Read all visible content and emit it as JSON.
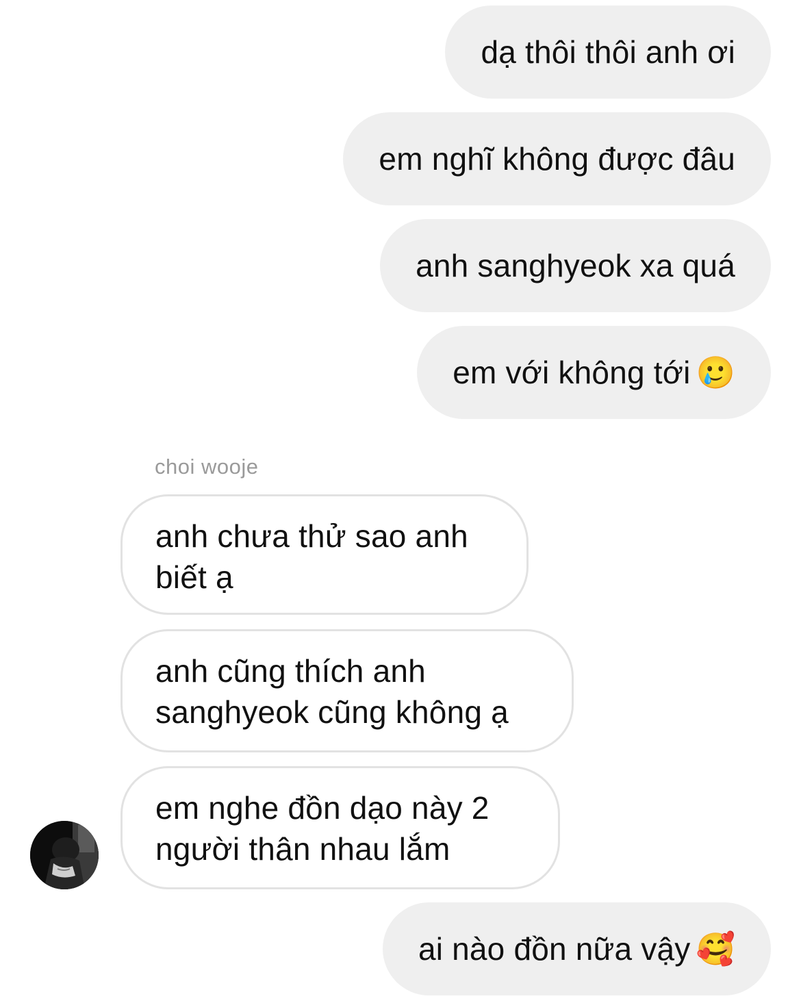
{
  "conversation": {
    "sender_name": "choi wooje",
    "messages": [
      {
        "direction": "outgoing",
        "text": "dạ thôi thôi anh ơi",
        "emoji": ""
      },
      {
        "direction": "outgoing",
        "text": "em nghĩ không được đâu",
        "emoji": ""
      },
      {
        "direction": "outgoing",
        "text": "anh sanghyeok xa quá",
        "emoji": ""
      },
      {
        "direction": "outgoing",
        "text": "em với không tới",
        "emoji": "🥲"
      },
      {
        "direction": "incoming",
        "text": "anh chưa thử sao anh biết ạ"
      },
      {
        "direction": "incoming",
        "text": "anh cũng thích anh sanghyeok cũng không ạ"
      },
      {
        "direction": "incoming",
        "text": "em nghe đồn dạo này 2 người thân nhau lắm"
      },
      {
        "direction": "outgoing",
        "text": "ai nào đồn nữa vậy",
        "emoji": "🥰"
      }
    ]
  },
  "colors": {
    "outgoing_bubble": "#efefef",
    "incoming_border": "#e2e2e2",
    "sender_name": "#9a9a9a"
  },
  "icons": {
    "avatar": "profile-photo"
  }
}
